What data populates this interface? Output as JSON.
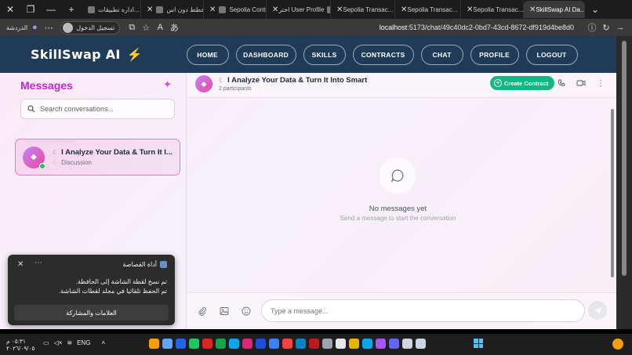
{
  "browser": {
    "tabs": [
      {
        "label": "اداره تطبيقات..."
      },
      {
        "label": "مخطط دون اس..."
      },
      {
        "label": "Sepolia Contra..."
      },
      {
        "label": "اختر User Profile"
      },
      {
        "label": "Sepolia Transac..."
      },
      {
        "label": "Sepolia Transac..."
      },
      {
        "label": "Sepolia Transac..."
      },
      {
        "label": "SkillSwap AI Da...",
        "active": true
      }
    ],
    "profile_label": "تسجيل الدخول",
    "reading_label": "الدردشة",
    "url_host": "localhost",
    "url_path": ":5173/chat/49c40dc2-0bd7-43cd-8672-df919d4be8d0"
  },
  "app": {
    "logo": "SkillSwap AI",
    "nav": [
      "HOME",
      "DASHBOARD",
      "SKILLS",
      "CONTRACTS",
      "CHAT",
      "PROFILE",
      "LOGOUT"
    ]
  },
  "sidebar": {
    "title": "Messages",
    "search_placeholder": "Search conversations...",
    "conversations": [
      {
        "name": "I Analyze Your Data & Turn It I...",
        "type": "Discussion"
      }
    ]
  },
  "chat": {
    "title": "I Analyze Your Data & Turn It Into Smart",
    "participants": "2 participants",
    "create_contract": "Create Contract",
    "empty_title": "No messages yet",
    "empty_subtitle": "Send a message to start the conversation",
    "input_placeholder": "Type a message..."
  },
  "toast": {
    "title": "أداة القصاصة",
    "line1": "تم نسخ لقطة الشاشة إلى الحافظة.",
    "line2": "تم الحفظ تلقائيا في مجلد لقطات الشاشة.",
    "button": "العلامات والمشاركة"
  },
  "taskbar": {
    "time": "٠٥:٣١ م",
    "date": "٢٠٢٦/٠٩/٠٥",
    "language": "ENG"
  },
  "colors": {
    "navbar": "#1f3b57",
    "accent": "#c026d3",
    "create_button": "#10b981"
  }
}
